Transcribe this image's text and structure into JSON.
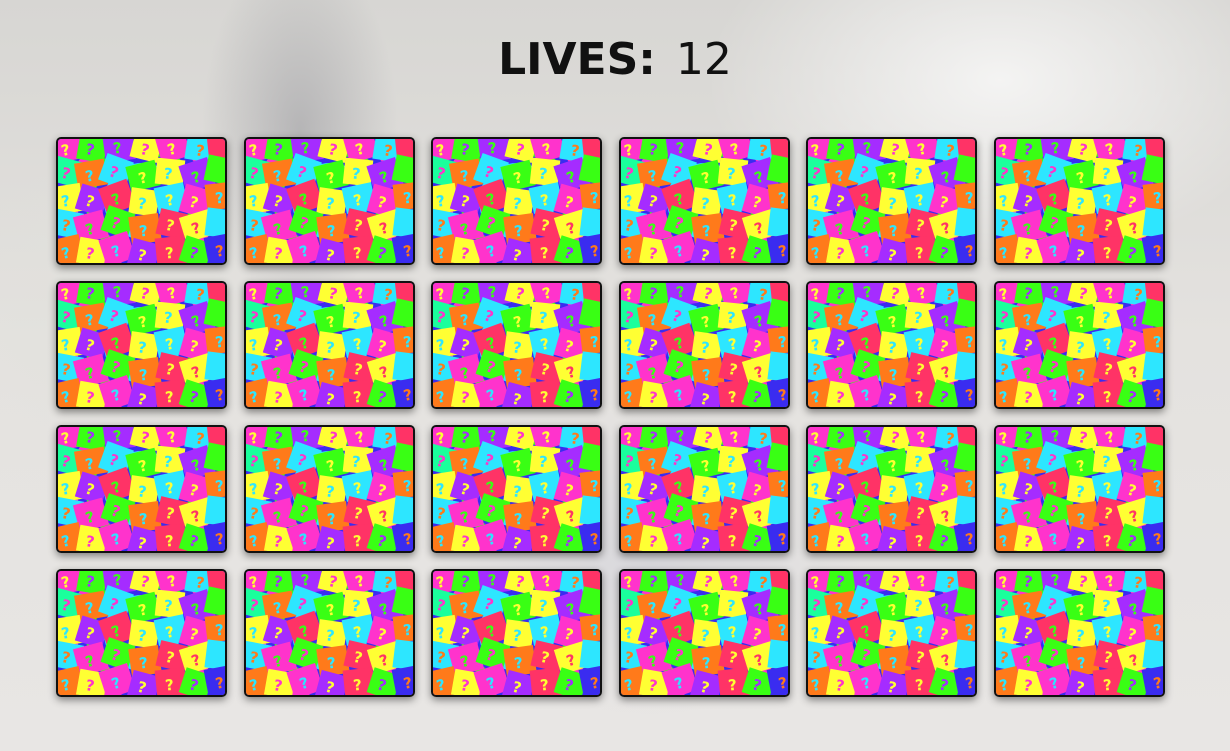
{
  "header": {
    "lives_label": "LIVES:",
    "lives_value": "12"
  },
  "board": {
    "rows": 4,
    "columns": 6,
    "card_count": 24,
    "card_state": "face-down",
    "card_back_icon": "question-mark-pattern-icon"
  },
  "colors": {
    "card_back_base": "#3a2cf0",
    "tile_colors": [
      "#ff33cc",
      "#39ff14",
      "#ffff33",
      "#2de6ff",
      "#ff3366",
      "#a52cff",
      "#ff7a1a",
      "#1aff9c"
    ],
    "text": "#111111"
  }
}
